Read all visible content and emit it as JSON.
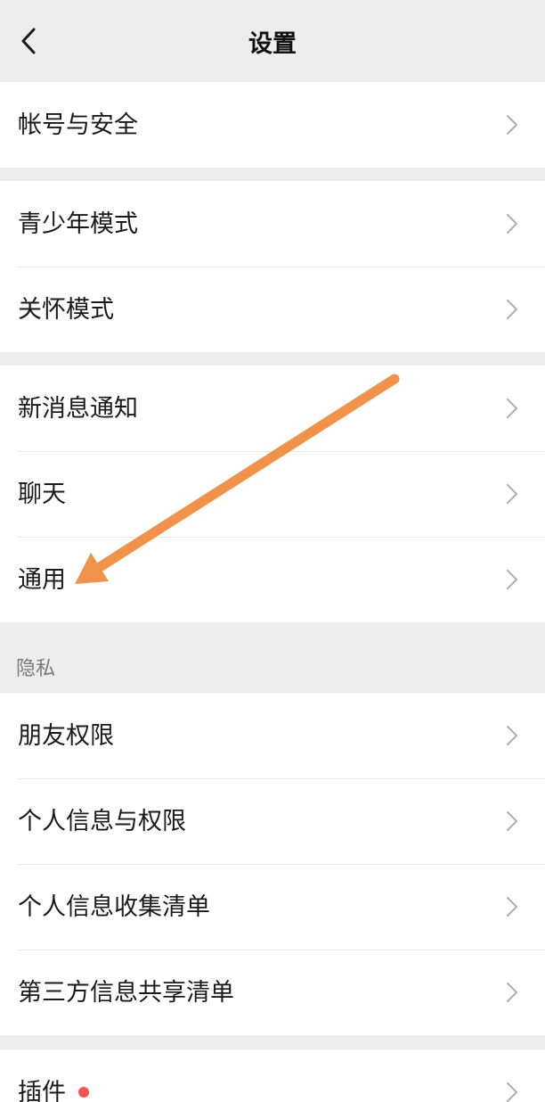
{
  "header": {
    "title": "设置",
    "back_icon": "chevron-left-icon"
  },
  "groups": [
    {
      "items": [
        "帐号与安全"
      ]
    },
    {
      "items": [
        "青少年模式",
        "关怀模式"
      ]
    },
    {
      "items": [
        "新消息通知",
        "聊天",
        "通用"
      ]
    },
    {
      "section_label": "隐私",
      "items": [
        "朋友权限",
        "个人信息与权限",
        "个人信息收集清单",
        "第三方信息共享清单"
      ]
    },
    {
      "items": [
        "插件"
      ]
    }
  ],
  "badges": {
    "plugin_dot_color": "#fa5151"
  },
  "annotation": {
    "type": "arrow",
    "points_to": "通用",
    "color": "#f0924a"
  },
  "colors": {
    "background": "#ededed",
    "card": "#ffffff",
    "text": "#1a1a1a",
    "chevron": "#b2b2b2"
  }
}
